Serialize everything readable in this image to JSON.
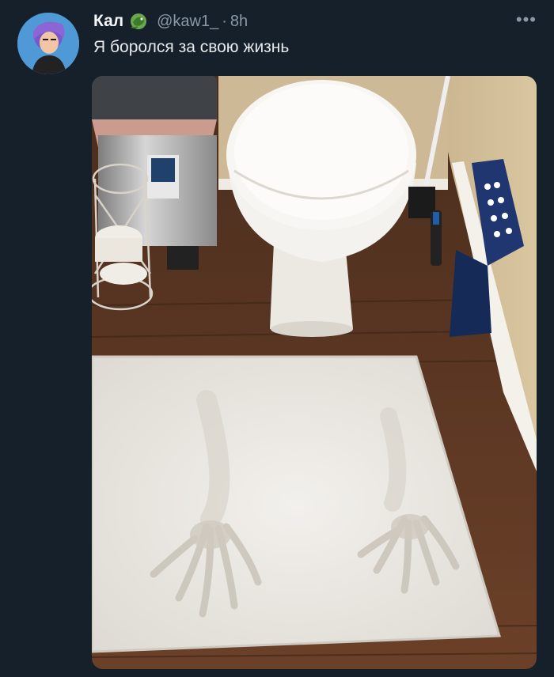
{
  "tweet": {
    "author_name": "Кал",
    "author_handle": "@kaw1_",
    "separator": "·",
    "timestamp": "8h",
    "text": "Я боролся за свою жизнь",
    "more_label": "•••"
  },
  "media": {
    "content": "photo: bathroom floor with white toilet, trash can, toilet paper holder, blue step stool, and white bath mat showing two hand prints and drag marks"
  },
  "colors": {
    "background": "#15202b",
    "text": "#e7e9ea",
    "secondary_text": "#8b98a5"
  },
  "icons": {
    "badge": "dragon-emoji-icon",
    "more": "more-options-icon"
  }
}
